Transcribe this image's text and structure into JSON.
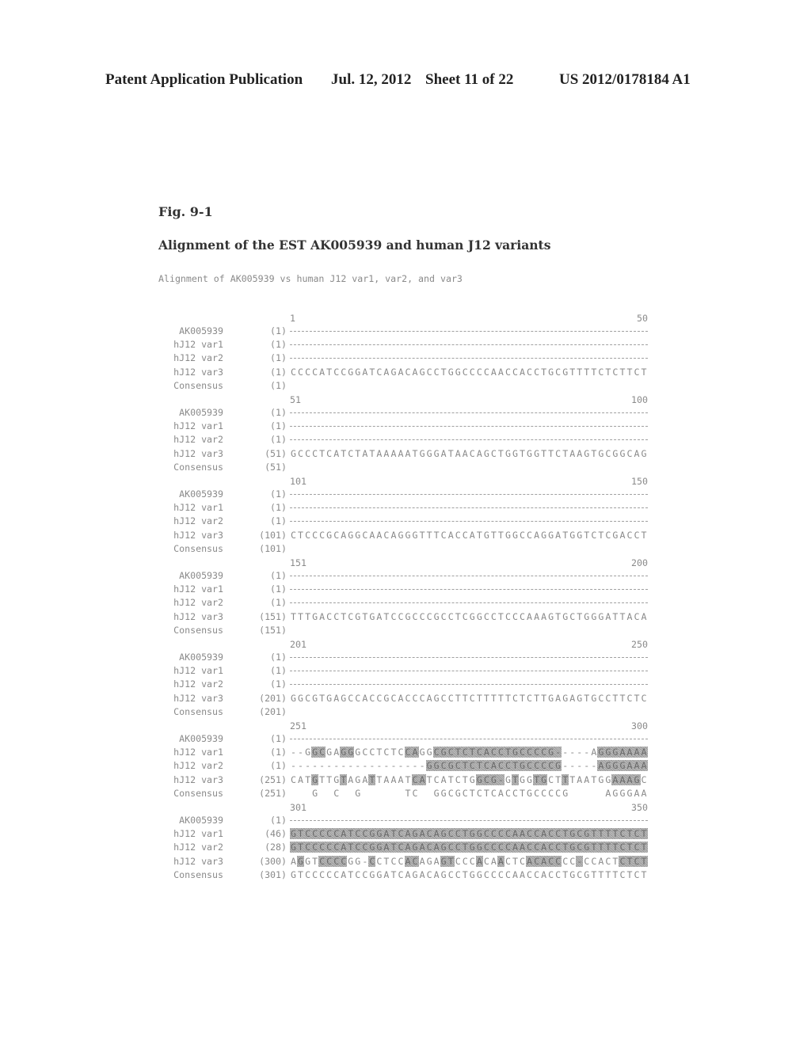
{
  "header": {
    "publication": "Patent Application Publication",
    "date": "Jul. 12, 2012",
    "sheet": "Sheet 11 of 22",
    "number": "US 2012/0178184 A1"
  },
  "figure": {
    "label": "Fig. 9-1",
    "title": "Alignment of the EST AK005939 and human J12 variants",
    "subtitle": "Alignment of AK005939 vs human J12 var1, var2, and var3"
  },
  "alignment": {
    "sequence_names": [
      "AK005939",
      "hJ12 var1",
      "hJ12 var2",
      "hJ12 var3",
      "Consensus"
    ],
    "blocks": [
      {
        "start": "1",
        "end": "50",
        "rows": [
          {
            "name": "AK005939",
            "pos": "(1)",
            "seq": "",
            "shade": ""
          },
          {
            "name": "hJ12 var1",
            "pos": "(1)",
            "seq": "",
            "shade": ""
          },
          {
            "name": "hJ12 var2",
            "pos": "(1)",
            "seq": "",
            "shade": ""
          },
          {
            "name": "hJ12 var3",
            "pos": "(1)",
            "seq": "CCCCATCCGGATCAGACAGCCTGGCCCCAACCACCTGCGTTTTCTCTTCT",
            "shade": ""
          },
          {
            "name": "Consensus",
            "pos": "(1)",
            "seq": "                                                  ",
            "shade": ""
          }
        ]
      },
      {
        "start": "51",
        "end": "100",
        "rows": [
          {
            "name": "AK005939",
            "pos": "(1)",
            "seq": "",
            "shade": ""
          },
          {
            "name": "hJ12 var1",
            "pos": "(1)",
            "seq": "",
            "shade": ""
          },
          {
            "name": "hJ12 var2",
            "pos": "(1)",
            "seq": "",
            "shade": ""
          },
          {
            "name": "hJ12 var3",
            "pos": "(51)",
            "seq": "GCCCTCATCTATAAAAATGGGATAACAGCTGGTGGTTCTAAGTGCGGCAG",
            "shade": ""
          },
          {
            "name": "Consensus",
            "pos": "(51)",
            "seq": "                                                  ",
            "shade": ""
          }
        ]
      },
      {
        "start": "101",
        "end": "150",
        "rows": [
          {
            "name": "AK005939",
            "pos": "(1)",
            "seq": "",
            "shade": ""
          },
          {
            "name": "hJ12 var1",
            "pos": "(1)",
            "seq": "",
            "shade": ""
          },
          {
            "name": "hJ12 var2",
            "pos": "(1)",
            "seq": "",
            "shade": ""
          },
          {
            "name": "hJ12 var3",
            "pos": "(101)",
            "seq": "CTCCCGCAGGCAACAGGGTTTCACCATGTTGGCCAGGATGGTCTCGACCT",
            "shade": ""
          },
          {
            "name": "Consensus",
            "pos": "(101)",
            "seq": "                                                  ",
            "shade": ""
          }
        ]
      },
      {
        "start": "151",
        "end": "200",
        "rows": [
          {
            "name": "AK005939",
            "pos": "(1)",
            "seq": "",
            "shade": ""
          },
          {
            "name": "hJ12 var1",
            "pos": "(1)",
            "seq": "",
            "shade": ""
          },
          {
            "name": "hJ12 var2",
            "pos": "(1)",
            "seq": "",
            "shade": ""
          },
          {
            "name": "hJ12 var3",
            "pos": "(151)",
            "seq": "TTTGACCTCGTGATCCGCCCGCCTCGGCCTCCCAAAGTGCTGGGATTACA",
            "shade": ""
          },
          {
            "name": "Consensus",
            "pos": "(151)",
            "seq": "                                                  ",
            "shade": ""
          }
        ]
      },
      {
        "start": "201",
        "end": "250",
        "rows": [
          {
            "name": "AK005939",
            "pos": "(1)",
            "seq": "",
            "shade": ""
          },
          {
            "name": "hJ12 var1",
            "pos": "(1)",
            "seq": "",
            "shade": ""
          },
          {
            "name": "hJ12 var2",
            "pos": "(1)",
            "seq": "",
            "shade": ""
          },
          {
            "name": "hJ12 var3",
            "pos": "(201)",
            "seq": "GGCGTGAGCCACCGCACCCAGCCTTCTTTTTCTCTTGAGAGTGCCTTCTC",
            "shade": ""
          },
          {
            "name": "Consensus",
            "pos": "(201)",
            "seq": "                                                  ",
            "shade": ""
          }
        ]
      },
      {
        "start": "251",
        "end": "300",
        "rows": [
          {
            "name": "AK005939",
            "pos": "(1)",
            "seq": "",
            "shade": ""
          },
          {
            "name": "hJ12 var1",
            "pos": "(1)",
            "seq": "--GGCGAGGGCCTCTCCAGGCGCTCTCACCTGCCCCG-----AGGGAAAA",
            "shade": "00011001100000001100111111111111111111000001111111"
          },
          {
            "name": "hJ12 var2",
            "pos": "(1)",
            "seq": "-------------------GGCGCTCTCACCTGCCCCG-----AGGGAAAA",
            "shade": "00000000000000000001111111111111111111000001111111"
          },
          {
            "name": "hJ12 var3",
            "pos": "(251)",
            "seq": "CATGTTGTAGATTAAATCATCATCTGGCG-GTGGTGCTTTAATGGAAAGC",
            "shade": "00010001000100000110000000111101001100100000011110"
          },
          {
            "name": "Consensus",
            "pos": "(251)",
            "seq": "   G  C  G      TC  GGCGCTCTCACCTGCCCCG     AGGGAAAA",
            "shade": ""
          }
        ]
      },
      {
        "start": "301",
        "end": "350",
        "rows": [
          {
            "name": "AK005939",
            "pos": "(1)",
            "seq": "",
            "shade": ""
          },
          {
            "name": "hJ12 var1",
            "pos": "(46)",
            "seq": "GTCCCCCATCCGGATCAGACAGCCTGGCCCCAACCACCTGCGTTTTCTCT",
            "shade": "11111111111111111111111111111111111111111111111111"
          },
          {
            "name": "hJ12 var2",
            "pos": "(28)",
            "seq": "GTCCCCCATCCGGATCAGACAGCCTGGCCCCAACCACCTGCGTTTTCTCT",
            "shade": "11111111111111111111111111111111111111111111111111"
          },
          {
            "name": "hJ12 var3",
            "pos": "(300)",
            "seq": "AGGTCCCCGG-CCTCCACAGAGTCCCACAACTCACACCCC-CCACTCTCT",
            "shade": "01001111000100001100011000100100011111001000001111"
          },
          {
            "name": "Consensus",
            "pos": "(301)",
            "seq": "GTCCCCCATCCGGATCAGACAGCCTGGCCCCAACCACCTGCGTTTTCTCT",
            "shade": ""
          }
        ]
      }
    ]
  }
}
